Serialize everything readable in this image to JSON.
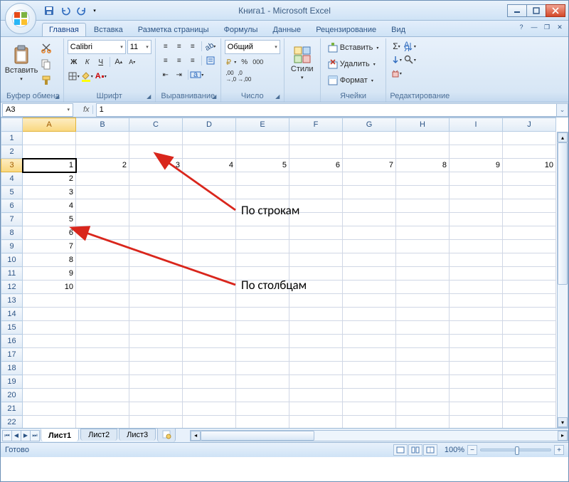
{
  "app": {
    "title": "Книга1 - Microsoft Excel"
  },
  "qat": {
    "save": "save-icon",
    "undo": "undo-icon",
    "redo": "redo-icon"
  },
  "tabs": {
    "items": [
      "Главная",
      "Вставка",
      "Разметка страницы",
      "Формулы",
      "Данные",
      "Рецензирование",
      "Вид"
    ],
    "active_index": 0
  },
  "ribbon": {
    "clipboard": {
      "label": "Буфер обмена",
      "paste": "Вставить"
    },
    "font": {
      "label": "Шрифт",
      "name": "Calibri",
      "size": "11",
      "bold": "Ж",
      "italic": "К",
      "underline": "Ч"
    },
    "alignment": {
      "label": "Выравнивание"
    },
    "number": {
      "label": "Число",
      "format": "Общий"
    },
    "styles": {
      "label": "Стили",
      "btn": "Стили"
    },
    "cells": {
      "label": "Ячейки",
      "insert": "Вставить",
      "delete": "Удалить",
      "format": "Формат"
    },
    "editing": {
      "label": "Редактирование"
    }
  },
  "namebox": {
    "ref": "A3"
  },
  "formula": {
    "fx": "fx",
    "value": "1"
  },
  "grid": {
    "columns": [
      "A",
      "B",
      "C",
      "D",
      "E",
      "F",
      "G",
      "H",
      "I",
      "J"
    ],
    "rows": 22,
    "active_cell": "A3",
    "row3": [
      "1",
      "2",
      "3",
      "4",
      "5",
      "6",
      "7",
      "8",
      "9",
      "10"
    ],
    "colA_from4": [
      "2",
      "3",
      "4",
      "5",
      "6",
      "7",
      "8",
      "9",
      "10"
    ]
  },
  "annotations": {
    "rows_label": "По строкам",
    "cols_label": "По столбцам"
  },
  "sheets": {
    "items": [
      "Лист1",
      "Лист2",
      "Лист3"
    ],
    "active_index": 0
  },
  "status": {
    "ready": "Готово",
    "zoom": "100%"
  }
}
